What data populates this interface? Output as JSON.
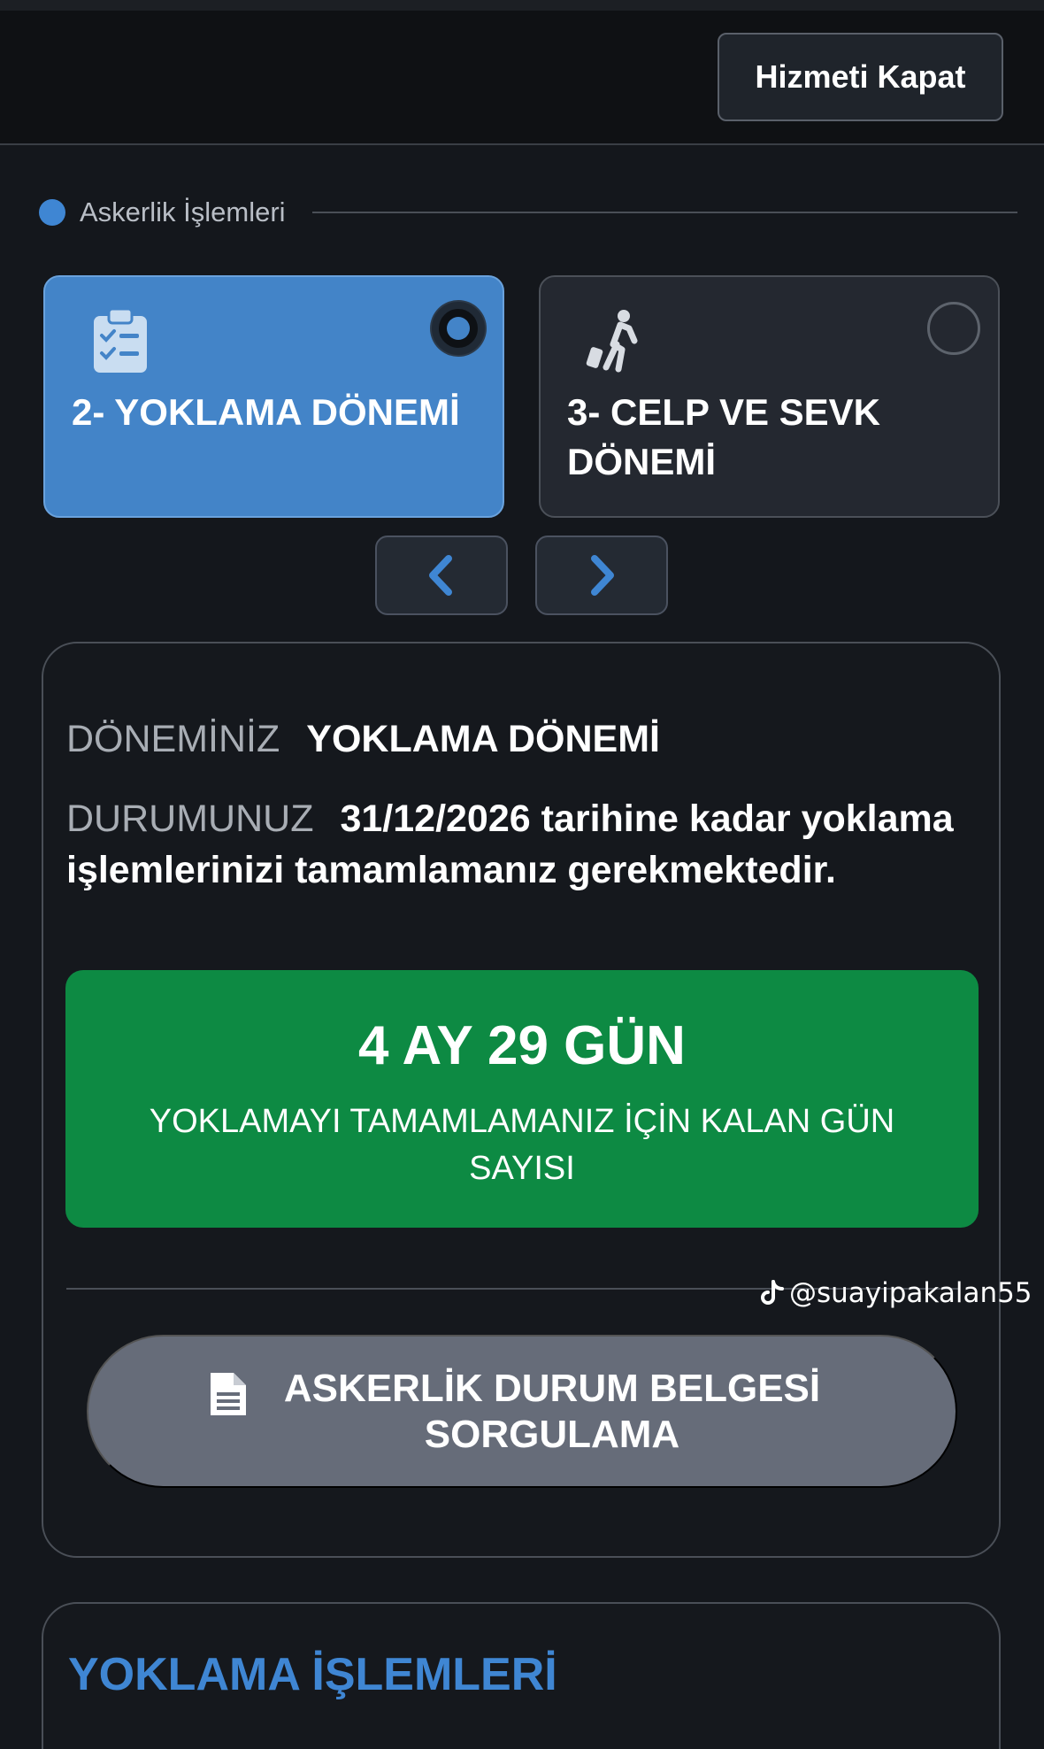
{
  "header": {
    "close_service_label": "Hizmeti Kapat"
  },
  "section": {
    "title": "Askerlik İşlemleri",
    "accent_color": "#3f86d3"
  },
  "periods": [
    {
      "label": "2- YOKLAMA DÖNEMİ",
      "icon": "clipboard-checklist-icon",
      "selected": true
    },
    {
      "label": "3- CELP VE SEVK DÖNEMİ",
      "icon": "traveler-luggage-icon",
      "selected": false
    }
  ],
  "navigation": {
    "prev_icon": "chevron-left-icon",
    "next_icon": "chevron-right-icon"
  },
  "status": {
    "period_key": "DÖNEMİNİZ",
    "period_value": "YOKLAMA DÖNEMİ",
    "state_key": "DURUMUNUZ",
    "state_value": "31/12/2026 tarihine kadar yoklama işlemlerinizi tamamlamanız gerekmektedir.",
    "countdown_value": "4 AY 29 GÜN",
    "countdown_caption": "YOKLAMAYI TAMAMLAMANIZ İÇİN KALAN GÜN SAYISI",
    "countdown_color": "#0d8a43"
  },
  "watermark": {
    "handle": "@suayipakalan55",
    "icon": "tiktok-icon"
  },
  "document_query": {
    "label": "ASKERLİK DURUM BELGESİ SORGULAMA",
    "icon": "document-icon"
  },
  "operations": {
    "title": "YOKLAMA İŞLEMLERİ"
  }
}
